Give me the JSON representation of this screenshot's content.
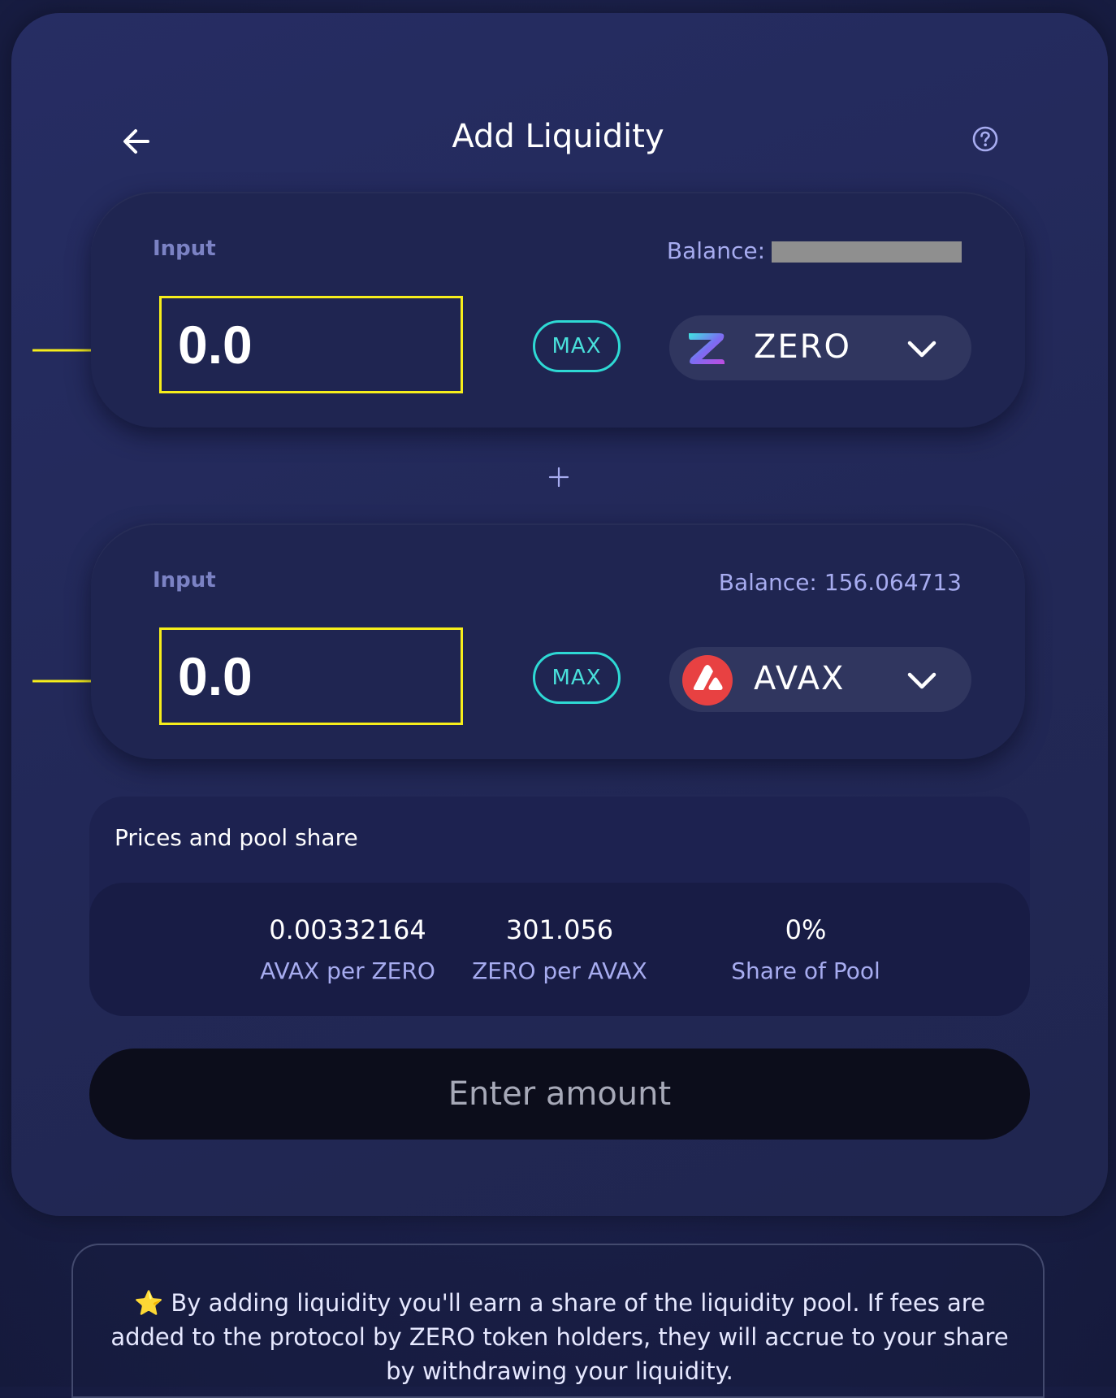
{
  "header": {
    "title": "Add Liquidity",
    "back_icon": "arrow-left-icon",
    "help_icon": "question-circle-icon"
  },
  "inputs": [
    {
      "label": "Input",
      "balance_label": "Balance:",
      "balance_value": "",
      "balance_redacted": true,
      "amount_placeholder": "0.0",
      "max_label": "MAX",
      "token": {
        "symbol": "ZERO",
        "icon": "zero-token-icon"
      }
    },
    {
      "label": "Input",
      "balance_text": "Balance: 156.064713",
      "amount_placeholder": "0.0",
      "max_label": "MAX",
      "token": {
        "symbol": "AVAX",
        "icon": "avax-token-icon"
      }
    }
  ],
  "plus_icon": "plus-icon",
  "prices": {
    "title": "Prices and pool share",
    "stats": [
      {
        "value": "0.00332164",
        "label": "AVAX per ZERO"
      },
      {
        "value": "301.056",
        "label": "ZERO per AVAX"
      },
      {
        "value": "0%",
        "label": "Share of Pool"
      }
    ]
  },
  "submit": {
    "label": "Enter amount"
  },
  "info": {
    "star": "⭐",
    "text": "By adding liquidity you'll earn a share of the liquidity pool. If fees are added to the protocol by ZERO token holders, they will accrue to your share by withdrawing your liquidity."
  },
  "colors": {
    "accent_teal": "#2ed9d4",
    "highlight_yellow": "#f6ee1b",
    "label_lavender": "#a7acf0",
    "avax_red": "#e84142"
  }
}
